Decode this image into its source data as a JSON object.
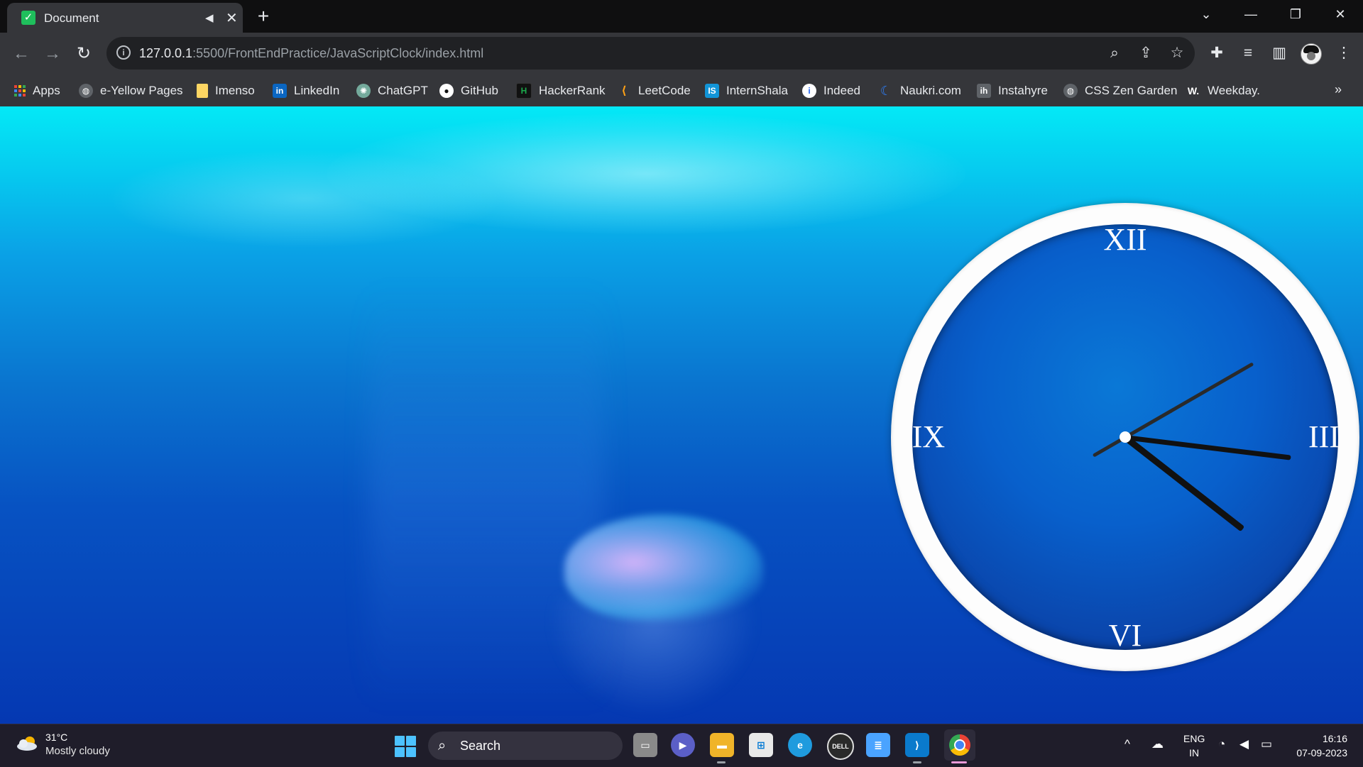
{
  "browser": {
    "tab": {
      "title": "Document"
    },
    "address": {
      "host": "127.0.0.1",
      "rest": ":5500/FrontEndPractice/JavaScriptClock/index.html"
    },
    "bookmarks": [
      {
        "label": "Apps",
        "icon": "apps-grid-icon",
        "color": "#ea4335"
      },
      {
        "label": "e-Yellow Pages",
        "icon": "globe-icon",
        "color": "#5f6368"
      },
      {
        "label": "Imenso",
        "icon": "folder-icon",
        "color": "#fdd663"
      },
      {
        "label": "LinkedIn",
        "icon": "linkedin-icon",
        "color": "#0a66c2"
      },
      {
        "label": "ChatGPT",
        "icon": "chatgpt-icon",
        "color": "#74aa9c"
      },
      {
        "label": "GitHub",
        "icon": "github-icon",
        "color": "#ffffff"
      },
      {
        "label": "HackerRank",
        "icon": "hackerrank-icon",
        "color": "#1ba94c"
      },
      {
        "label": "LeetCode",
        "icon": "leetcode-icon",
        "color": "#ffa116"
      },
      {
        "label": "InternShala",
        "icon": "internshala-icon",
        "color": "#1295d8"
      },
      {
        "label": "Indeed",
        "icon": "indeed-icon",
        "color": "#ffffff"
      },
      {
        "label": "Naukri.com",
        "icon": "naukri-icon",
        "color": "#2d7ff9"
      },
      {
        "label": "Instahyre",
        "icon": "instahyre-icon",
        "color": "#5f6368"
      },
      {
        "label": "CSS Zen Garden",
        "icon": "globe-icon",
        "color": "#5f6368"
      },
      {
        "label": "Weekday.",
        "icon": "weekday-icon",
        "color": "#ffffff"
      }
    ]
  },
  "clock": {
    "numerals": {
      "n12": "XII",
      "n3": "III",
      "n6": "VI",
      "n9": "IX"
    },
    "time": {
      "hours": 4,
      "minutes": 16,
      "seconds": 10
    }
  },
  "taskbar": {
    "weather": {
      "temp": "31°C",
      "condition": "Mostly cloudy"
    },
    "search_label": "Search",
    "lang": {
      "line1": "ENG",
      "line2": "IN"
    },
    "time": "16:16",
    "date": "07-09-2023"
  },
  "colors": {
    "accent_blue": "#0860cc",
    "water_top": "#04e9f6",
    "water_bottom": "#0538b2"
  }
}
